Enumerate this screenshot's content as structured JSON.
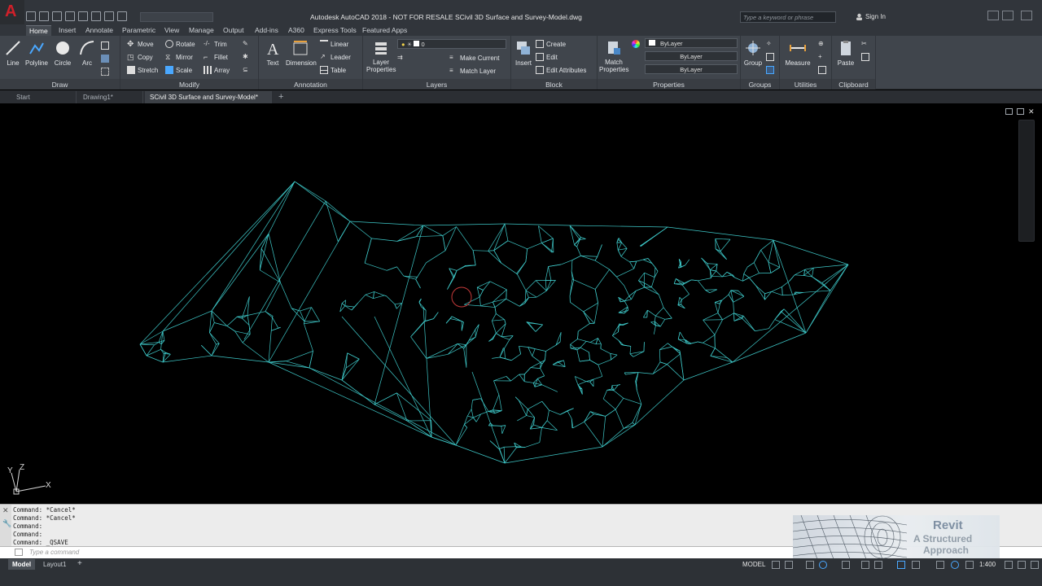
{
  "app": {
    "logo_letter": "A",
    "title": "Autodesk AutoCAD 2018 - NOT FOR RESALE    SCivil 3D Surface and Survey-Model.dwg",
    "search_placeholder": "Type a keyword or phrase",
    "sign_in": "Sign In"
  },
  "ribbon_tabs": [
    "Home",
    "Insert",
    "Annotate",
    "Parametric",
    "View",
    "Manage",
    "Output",
    "Add-ins",
    "A360",
    "Express Tools",
    "Featured Apps"
  ],
  "ribbon": {
    "draw": {
      "title": "Draw",
      "buttons": [
        "Line",
        "Polyline",
        "Circle",
        "Arc"
      ]
    },
    "modify": {
      "title": "Modify",
      "items": [
        "Move",
        "Rotate",
        "Trim",
        "Copy",
        "Mirror",
        "Fillet",
        "Stretch",
        "Scale",
        "Array"
      ]
    },
    "annotation": {
      "title": "Annotation",
      "buttons": [
        "Text",
        "Dimension"
      ],
      "items": [
        "Linear",
        "Leader",
        "Table"
      ]
    },
    "layers": {
      "title": "Layers",
      "button": "Layer Properties",
      "combo_value": "0",
      "items": [
        "Make Current",
        "Match Layer"
      ]
    },
    "block": {
      "title": "Block",
      "button": "Insert",
      "items": [
        "Create",
        "Edit",
        "Edit Attributes"
      ]
    },
    "properties": {
      "title": "Properties",
      "button": "Match Properties",
      "combos": [
        "ByLayer",
        "ByLayer",
        "ByLayer"
      ]
    },
    "groups": {
      "title": "Groups",
      "button": "Group"
    },
    "utilities": {
      "title": "Utilities",
      "button": "Measure"
    },
    "clipboard": {
      "title": "Clipboard",
      "button": "Paste"
    }
  },
  "doc_tabs": [
    "Start",
    "Drawing1*",
    "SCivil 3D Surface and Survey-Model*"
  ],
  "viewport": {
    "ucs_labels": [
      "Y",
      "Z",
      "X"
    ],
    "mesh_color": "#3ec8c8"
  },
  "command_history": [
    "Command: *Cancel*",
    "Command: *Cancel*",
    "Command:",
    "Command:",
    "Command: _QSAVE"
  ],
  "command_placeholder": "Type a command",
  "watermark": {
    "title": "Revit",
    "line1": "A Structured",
    "line2": "Approach"
  },
  "layout_tabs": [
    "Model",
    "Layout1"
  ],
  "status": {
    "model": "MODEL",
    "scale": "1:400"
  }
}
